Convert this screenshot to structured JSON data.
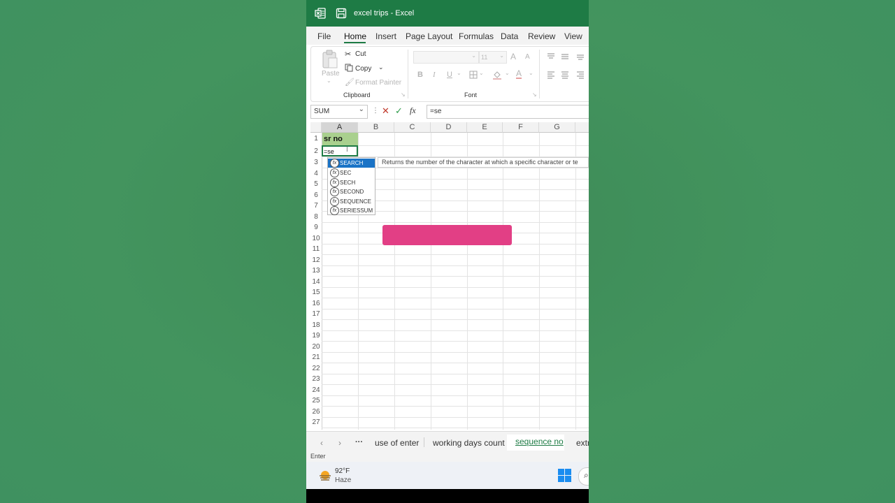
{
  "window": {
    "title": "excel trips  -  Excel"
  },
  "menu": {
    "tabs": [
      "File",
      "Home",
      "Insert",
      "Page Layout",
      "Formulas",
      "Data",
      "Review",
      "View"
    ],
    "active": "Home"
  },
  "ribbon": {
    "clipboard": {
      "paste": "Paste",
      "cut": "Cut",
      "copy": "Copy",
      "format_painter": "Format Painter",
      "group_label": "Clipboard"
    },
    "font": {
      "font_size": "11",
      "bold": "B",
      "italic": "I",
      "underline": "U",
      "group_label": "Font",
      "grow": "A",
      "shrink": "A",
      "font_color": "A"
    }
  },
  "formula_bar": {
    "name_box": "SUM",
    "fx": "fx",
    "value": "=se"
  },
  "grid": {
    "columns": [
      "A",
      "B",
      "C",
      "D",
      "E",
      "F",
      "G"
    ],
    "rows": [
      "1",
      "2",
      "3",
      "4",
      "5",
      "6",
      "7",
      "8",
      "9",
      "10",
      "11",
      "12",
      "13",
      "14",
      "15",
      "16",
      "17",
      "18",
      "19",
      "20",
      "21",
      "22",
      "23",
      "24",
      "25",
      "26",
      "27"
    ],
    "cells": {
      "A1": "sr no",
      "A2": "=se"
    }
  },
  "autocomplete": {
    "items": [
      "SEARCH",
      "SEC",
      "SECH",
      "SECOND",
      "SEQUENCE",
      "SERIESSUM"
    ],
    "selected": 0,
    "tooltip": "Returns the number of the character at which a specific character or te"
  },
  "sheet_tabs": {
    "ellipsis": "···",
    "tabs": [
      "use of enter",
      "working days count",
      "sequence no",
      "extr"
    ],
    "active": "sequence no"
  },
  "status": {
    "mode": "Enter"
  },
  "taskbar": {
    "temperature": "92°F",
    "condition": "Haze"
  },
  "colors": {
    "excel_green": "#1e7b45",
    "header_green": "#a9d08e",
    "selection": "#1a73c6",
    "accent_pink": "#e23f85"
  }
}
